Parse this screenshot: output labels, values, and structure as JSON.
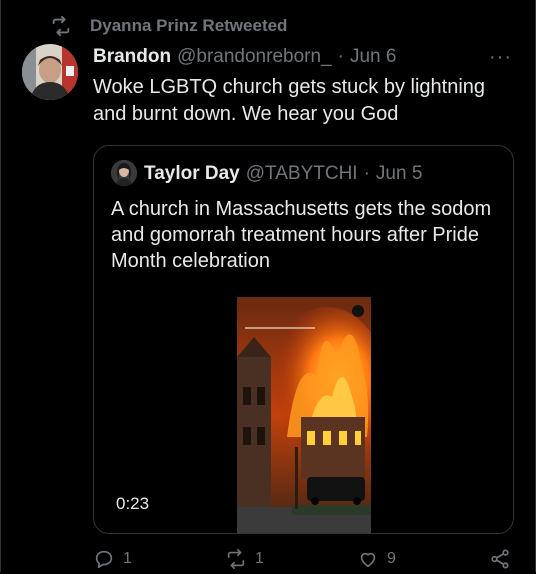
{
  "retweet": {
    "text": "Dyanna Prinz Retweeted",
    "icon": "retweet-icon"
  },
  "tweet": {
    "name": "Brandon",
    "handle": "@brandonreborn_",
    "separator": "·",
    "date": "Jun 6",
    "more": "···",
    "text": "Woke LGBTQ church gets stuck by lightning and burnt down. We hear you God"
  },
  "quote": {
    "name": "Taylor Day",
    "handle": "@TABYTCHI",
    "separator": "·",
    "date": "Jun 5",
    "text": "A church in Massachusetts gets the sodom and gomorrah treatment hours after Pride Month celebration",
    "video": {
      "duration": "0:23"
    }
  },
  "actions": {
    "replies": "1",
    "retweets": "1",
    "likes": "9"
  },
  "colors": {
    "background": "#000000",
    "text": "#e7e9ea",
    "muted": "#71767b",
    "border": "#2f3336"
  }
}
